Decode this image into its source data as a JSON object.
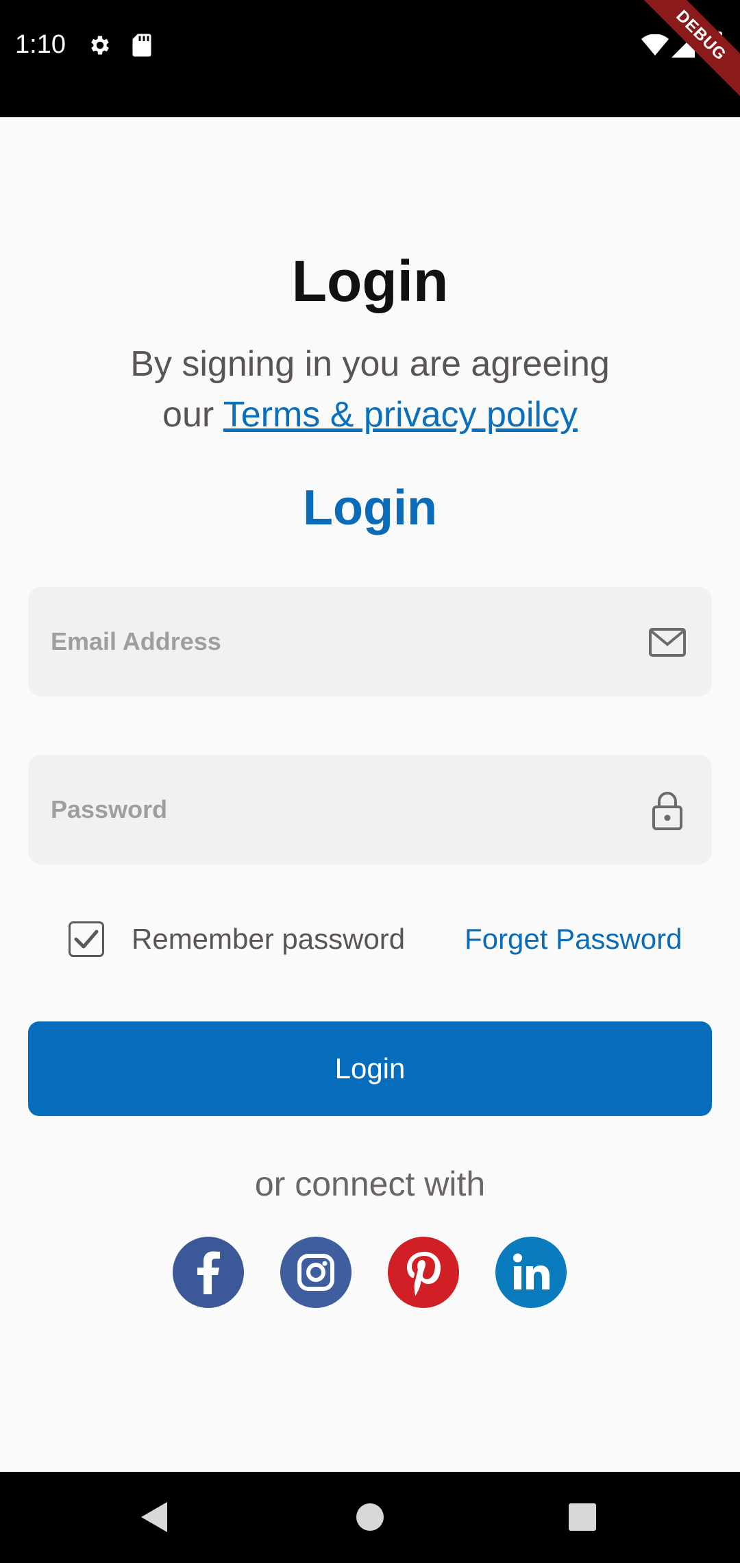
{
  "status_bar": {
    "time": "1:10",
    "debug_label": "DEBUG"
  },
  "page": {
    "title": "Login",
    "subtitle_line1": "By signing in you are agreeing",
    "subtitle_prefix": "our",
    "terms_link": "Terms & privacy poilcy",
    "section_title": "Login"
  },
  "form": {
    "email_placeholder": "Email Address",
    "email_value": "",
    "password_placeholder": "Password",
    "password_value": "",
    "remember_label": "Remember password",
    "remember_checked": true,
    "forget_link": "Forget Password",
    "login_button": "Login"
  },
  "social": {
    "connect_text": "or connect with",
    "providers": [
      "facebook",
      "instagram",
      "pinterest",
      "linkedin"
    ]
  },
  "colors": {
    "accent": "#066dbc",
    "facebook": "#3b5998",
    "instagram": "#3f5e9e",
    "pinterest": "#d11f26",
    "linkedin": "#0a7bbd"
  },
  "icons": {
    "email": "mail-icon",
    "password": "lock-icon",
    "checkbox": "check-icon"
  }
}
